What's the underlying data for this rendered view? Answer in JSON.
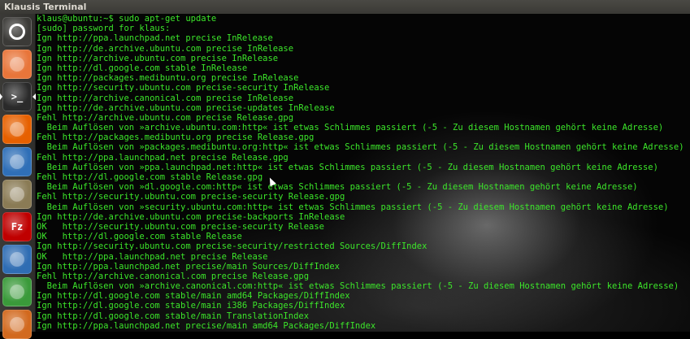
{
  "window": {
    "title": "Klausis Terminal"
  },
  "launcher": {
    "items": [
      {
        "icon": "ubuntu-dash-icon",
        "color": "#3b3a37"
      },
      {
        "icon": "files-folder-icon",
        "color": "#e8753a"
      },
      {
        "icon": "terminal-icon",
        "color": "#2a2a2a",
        "glyph": ">_"
      },
      {
        "icon": "firefox-icon",
        "color": "#e66000"
      },
      {
        "icon": "thunderbird-icon",
        "color": "#2f6fb7"
      },
      {
        "icon": "gimp-icon",
        "color": "#8a7b55"
      },
      {
        "icon": "filezilla-icon",
        "color": "#bf0000",
        "glyph": "Fz"
      },
      {
        "icon": "libreoffice-writer-icon",
        "color": "#2f6db3"
      },
      {
        "icon": "libreoffice-calc-icon",
        "color": "#3a9a3a"
      },
      {
        "icon": "libreoffice-impress-icon",
        "color": "#d2691e"
      }
    ]
  },
  "terminal": {
    "lines": [
      "klaus@ubuntu:~$ sudo apt-get update",
      "[sudo] password for klaus:",
      "Ign http://ppa.launchpad.net precise InRelease",
      "Ign http://de.archive.ubuntu.com precise InRelease",
      "Ign http://archive.ubuntu.com precise InRelease",
      "Ign http://dl.google.com stable InRelease",
      "Ign http://packages.medibuntu.org precise InRelease",
      "Ign http://security.ubuntu.com precise-security InRelease",
      "Ign http://archive.canonical.com precise InRelease",
      "Ign http://de.archive.ubuntu.com precise-updates InRelease",
      "Fehl http://archive.ubuntu.com precise Release.gpg",
      "  Beim Auflösen von »archive.ubuntu.com:http« ist etwas Schlimmes passiert (-5 - Zu diesem Hostnamen gehört keine Adresse)",
      "Fehl http://packages.medibuntu.org precise Release.gpg",
      "  Beim Auflösen von »packages.medibuntu.org:http« ist etwas Schlimmes passiert (-5 - Zu diesem Hostnamen gehört keine Adresse)",
      "Fehl http://ppa.launchpad.net precise Release.gpg",
      "  Beim Auflösen von »ppa.launchpad.net:http« ist etwas Schlimmes passiert (-5 - Zu diesem Hostnamen gehört keine Adresse)",
      "Fehl http://dl.google.com stable Release.gpg",
      "  Beim Auflösen von »dl.google.com:http« ist etwas Schlimmes passiert (-5 - Zu diesem Hostnamen gehört keine Adresse)",
      "Fehl http://security.ubuntu.com precise-security Release.gpg",
      "  Beim Auflösen von »security.ubuntu.com:http« ist etwas Schlimmes passiert (-5 - Zu diesem Hostnamen gehört keine Adresse)",
      "Ign http://de.archive.ubuntu.com precise-backports InRelease",
      "OK   http://security.ubuntu.com precise-security Release",
      "OK   http://dl.google.com stable Release",
      "Ign http://security.ubuntu.com precise-security/restricted Sources/DiffIndex",
      "OK   http://ppa.launchpad.net precise Release",
      "Ign http://ppa.launchpad.net precise/main Sources/DiffIndex",
      "Fehl http://archive.canonical.com precise Release.gpg",
      "  Beim Auflösen von »archive.canonical.com:http« ist etwas Schlimmes passiert (-5 - Zu diesem Hostnamen gehört keine Adresse)",
      "Ign http://dl.google.com stable/main amd64 Packages/DiffIndex",
      "Ign http://dl.google.com stable/main i386 Packages/DiffIndex",
      "Ign http://dl.google.com stable/main TranslationIndex",
      "Ign http://ppa.launchpad.net precise/main amd64 Packages/DiffIndex"
    ],
    "text_color": "#3ce62a"
  }
}
